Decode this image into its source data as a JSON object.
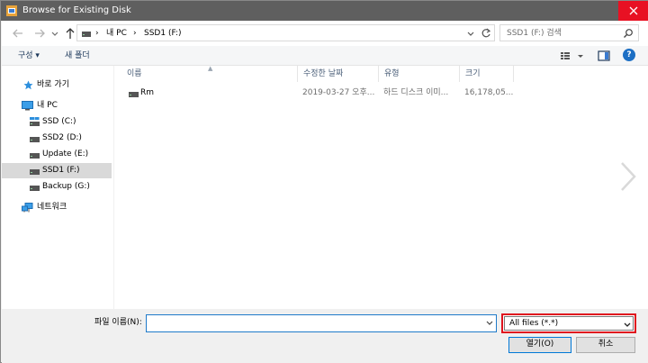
{
  "window": {
    "title": "Browse for Existing Disk"
  },
  "address": {
    "crumbs": [
      "내 PC",
      "SSD1 (F:)"
    ]
  },
  "search": {
    "placeholder": "SSD1 (F:) 검색"
  },
  "toolbar": {
    "organize_label": "구성 ▾",
    "new_folder_label": "새 폴더"
  },
  "sidebar": {
    "items": [
      {
        "label": "바로 가기",
        "icon": "star-icon"
      },
      {
        "label": "내 PC",
        "icon": "computer-icon"
      },
      {
        "label": "SSD (C:)",
        "icon": "drive-icon"
      },
      {
        "label": "SSD2 (D:)",
        "icon": "drive-icon"
      },
      {
        "label": "Update (E:)",
        "icon": "drive-icon"
      },
      {
        "label": "SSD1 (F:)",
        "icon": "drive-icon",
        "selected": true
      },
      {
        "label": "Backup (G:)",
        "icon": "drive-icon"
      },
      {
        "label": "네트워크",
        "icon": "network-icon"
      }
    ]
  },
  "columns": [
    "이름",
    "수정한 날짜",
    "유형",
    "크기"
  ],
  "files": [
    {
      "name": "Rm",
      "date": "2019-03-27 오후...",
      "type": "하드 디스크 이미...",
      "size": "16,178,05..."
    }
  ],
  "footer": {
    "filename_label": "파일 이름(N):",
    "filename_value": "",
    "filetype_value": "All files (*.*)",
    "open_label": "열기(O)",
    "cancel_label": "취소"
  },
  "colors": {
    "titlebar": "#5f5f5f",
    "close": "#e81123",
    "highlight_border": "#e0141e",
    "accent": "#0078d7"
  }
}
